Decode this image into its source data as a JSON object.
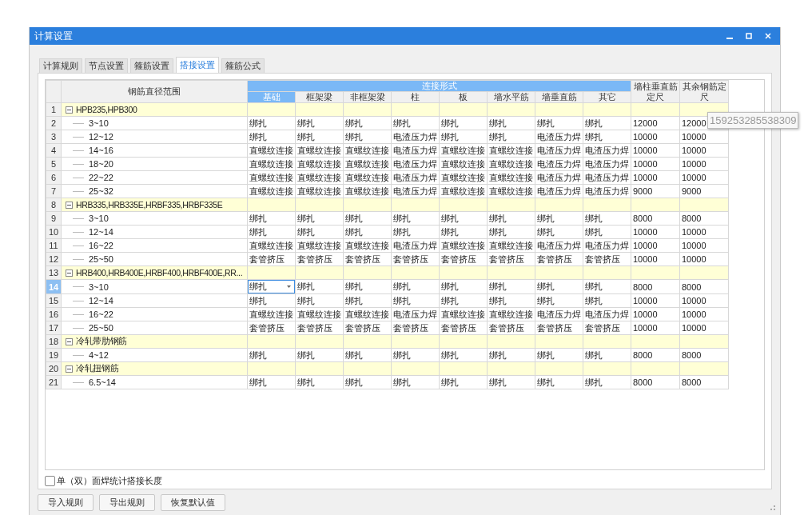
{
  "window": {
    "title": "计算设置"
  },
  "tabs": [
    {
      "label": "计算规则",
      "selected": false
    },
    {
      "label": "节点设置",
      "selected": false
    },
    {
      "label": "箍筋设置",
      "selected": false
    },
    {
      "label": "搭接设置",
      "selected": true
    },
    {
      "label": "箍筋公式",
      "selected": false
    }
  ],
  "table": {
    "range_header": "钢筋直径范围",
    "group_header": "连接形式",
    "connection_columns": [
      {
        "label": "基础",
        "selected": true
      },
      {
        "label": "框架梁",
        "selected": false
      },
      {
        "label": "非框架梁",
        "selected": false
      },
      {
        "label": "柱",
        "selected": false
      },
      {
        "label": "板",
        "selected": false
      },
      {
        "label": "墙水平筋",
        "selected": false
      },
      {
        "label": "墙垂直筋",
        "selected": false
      },
      {
        "label": "其它",
        "selected": false
      }
    ],
    "extra_columns": [
      "墙柱垂直筋定尺",
      "其余钢筋定尺"
    ],
    "groups": [
      {
        "no": "1",
        "label": "HPB235,HPB300",
        "expanded": true,
        "children": [
          {
            "no": "2",
            "label": "3~10",
            "selected": false,
            "cells": [
              "绑扎",
              "绑扎",
              "绑扎",
              "绑扎",
              "绑扎",
              "绑扎",
              "绑扎",
              "绑扎",
              "12000",
              "12000"
            ]
          },
          {
            "no": "3",
            "label": "12~12",
            "selected": false,
            "cells": [
              "绑扎",
              "绑扎",
              "绑扎",
              "电渣压力焊",
              "绑扎",
              "绑扎",
              "电渣压力焊",
              "绑扎",
              "10000",
              "10000"
            ]
          },
          {
            "no": "4",
            "label": "14~16",
            "selected": false,
            "cells": [
              "直螺纹连接",
              "直螺纹连接",
              "直螺纹连接",
              "电渣压力焊",
              "直螺纹连接",
              "直螺纹连接",
              "电渣压力焊",
              "电渣压力焊",
              "10000",
              "10000"
            ]
          },
          {
            "no": "5",
            "label": "18~20",
            "selected": false,
            "cells": [
              "直螺纹连接",
              "直螺纹连接",
              "直螺纹连接",
              "电渣压力焊",
              "直螺纹连接",
              "直螺纹连接",
              "电渣压力焊",
              "电渣压力焊",
              "10000",
              "10000"
            ]
          },
          {
            "no": "6",
            "label": "22~22",
            "selected": false,
            "cells": [
              "直螺纹连接",
              "直螺纹连接",
              "直螺纹连接",
              "电渣压力焊",
              "直螺纹连接",
              "直螺纹连接",
              "电渣压力焊",
              "电渣压力焊",
              "10000",
              "10000"
            ]
          },
          {
            "no": "7",
            "label": "25~32",
            "selected": false,
            "cells": [
              "直螺纹连接",
              "直螺纹连接",
              "直螺纹连接",
              "电渣压力焊",
              "直螺纹连接",
              "直螺纹连接",
              "电渣压力焊",
              "电渣压力焊",
              "9000",
              "9000"
            ]
          }
        ]
      },
      {
        "no": "8",
        "label": "HRB335,HRB335E,HRBF335,HRBF335E",
        "expanded": true,
        "children": [
          {
            "no": "9",
            "label": "3~10",
            "selected": false,
            "cells": [
              "绑扎",
              "绑扎",
              "绑扎",
              "绑扎",
              "绑扎",
              "绑扎",
              "绑扎",
              "绑扎",
              "8000",
              "8000"
            ]
          },
          {
            "no": "10",
            "label": "12~14",
            "selected": false,
            "cells": [
              "绑扎",
              "绑扎",
              "绑扎",
              "绑扎",
              "绑扎",
              "绑扎",
              "绑扎",
              "绑扎",
              "10000",
              "10000"
            ]
          },
          {
            "no": "11",
            "label": "16~22",
            "selected": false,
            "cells": [
              "直螺纹连接",
              "直螺纹连接",
              "直螺纹连接",
              "电渣压力焊",
              "直螺纹连接",
              "直螺纹连接",
              "电渣压力焊",
              "电渣压力焊",
              "10000",
              "10000"
            ]
          },
          {
            "no": "12",
            "label": "25~50",
            "selected": false,
            "cells": [
              "套管挤压",
              "套管挤压",
              "套管挤压",
              "套管挤压",
              "套管挤压",
              "套管挤压",
              "套管挤压",
              "套管挤压",
              "10000",
              "10000"
            ]
          }
        ]
      },
      {
        "no": "13",
        "label": "HRB400,HRB400E,HRBF400,HRBF400E,RR...",
        "expanded": true,
        "children": [
          {
            "no": "14",
            "label": "3~10",
            "selected": true,
            "cells": [
              "绑扎",
              "绑扎",
              "绑扎",
              "绑扎",
              "绑扎",
              "绑扎",
              "绑扎",
              "绑扎",
              "8000",
              "8000"
            ]
          },
          {
            "no": "15",
            "label": "12~14",
            "selected": false,
            "cells": [
              "绑扎",
              "绑扎",
              "绑扎",
              "绑扎",
              "绑扎",
              "绑扎",
              "绑扎",
              "绑扎",
              "10000",
              "10000"
            ]
          },
          {
            "no": "16",
            "label": "16~22",
            "selected": false,
            "cells": [
              "直螺纹连接",
              "直螺纹连接",
              "直螺纹连接",
              "电渣压力焊",
              "直螺纹连接",
              "直螺纹连接",
              "电渣压力焊",
              "电渣压力焊",
              "10000",
              "10000"
            ]
          },
          {
            "no": "17",
            "label": "25~50",
            "selected": false,
            "cells": [
              "套管挤压",
              "套管挤压",
              "套管挤压",
              "套管挤压",
              "套管挤压",
              "套管挤压",
              "套管挤压",
              "套管挤压",
              "10000",
              "10000"
            ]
          }
        ]
      },
      {
        "no": "18",
        "label": "冷轧带肋钢筋",
        "expanded": true,
        "children": [
          {
            "no": "19",
            "label": "4~12",
            "selected": false,
            "cells": [
              "绑扎",
              "绑扎",
              "绑扎",
              "绑扎",
              "绑扎",
              "绑扎",
              "绑扎",
              "绑扎",
              "8000",
              "8000"
            ]
          }
        ]
      },
      {
        "no": "20",
        "label": "冷轧扭钢筋",
        "expanded": true,
        "children": [
          {
            "no": "21",
            "label": "6.5~14",
            "selected": false,
            "cells": [
              "绑扎",
              "绑扎",
              "绑扎",
              "绑扎",
              "绑扎",
              "绑扎",
              "绑扎",
              "绑扎",
              "8000",
              "8000"
            ]
          }
        ]
      }
    ]
  },
  "tooltip": {
    "text": "159253285538309"
  },
  "checkbox": {
    "label": "单（双）面焊统计搭接长度",
    "checked": false
  },
  "buttons": [
    "导入规则",
    "导出规则",
    "恢复默认值"
  ]
}
